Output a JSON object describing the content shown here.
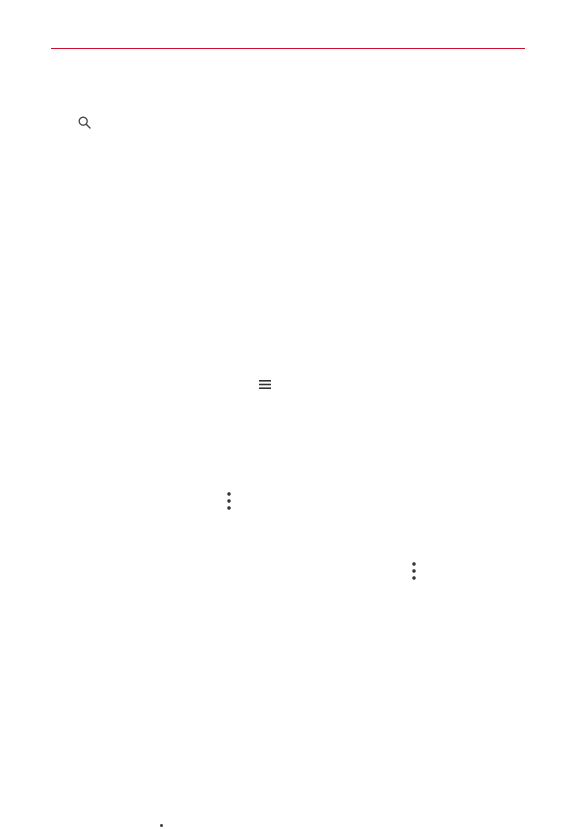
{
  "page": {
    "accent_color": "#c8102e",
    "ink_color": "#333333"
  },
  "icons": {
    "search": "search-icon",
    "menu": "menu-icon",
    "overflow_a": "more-vertical-icon",
    "overflow_b": "more-vertical-icon"
  }
}
